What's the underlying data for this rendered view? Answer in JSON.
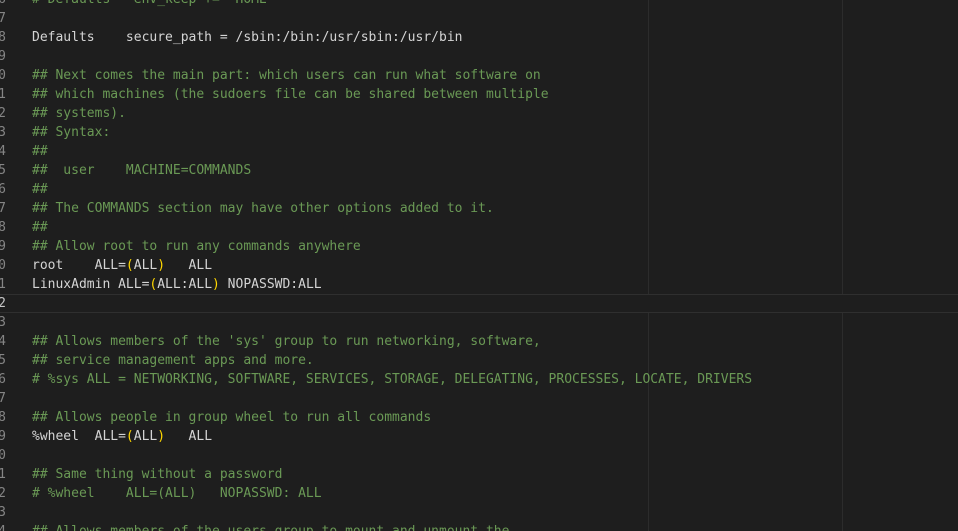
{
  "editor": {
    "colors": {
      "background": "#1e1e1e",
      "comment": "#6a9955",
      "text": "#d4d4d4",
      "bracket": "#ffd700",
      "line_number": "#858585"
    },
    "current_line_index": 16,
    "lines": [
      {
        "num": "6",
        "segments": [
          {
            "t": "comment",
            "v": "# Defaults   env_keep += \"HOME\""
          }
        ]
      },
      {
        "num": "7",
        "segments": []
      },
      {
        "num": "8",
        "segments": [
          {
            "t": "plain",
            "v": "Defaults    secure_path = /sbin:/bin:/usr/sbin:/usr/bin"
          }
        ]
      },
      {
        "num": "9",
        "segments": []
      },
      {
        "num": "0",
        "segments": [
          {
            "t": "comment",
            "v": "## Next comes the main part: which users can run what software on"
          }
        ]
      },
      {
        "num": "1",
        "segments": [
          {
            "t": "comment",
            "v": "## which machines (the sudoers file can be shared between multiple"
          }
        ]
      },
      {
        "num": "2",
        "segments": [
          {
            "t": "comment",
            "v": "## systems)."
          }
        ]
      },
      {
        "num": "3",
        "segments": [
          {
            "t": "comment",
            "v": "## Syntax:"
          }
        ]
      },
      {
        "num": "4",
        "segments": [
          {
            "t": "comment",
            "v": "##"
          }
        ]
      },
      {
        "num": "5",
        "segments": [
          {
            "t": "comment",
            "v": "##  user    MACHINE=COMMANDS"
          }
        ]
      },
      {
        "num": "6",
        "segments": [
          {
            "t": "comment",
            "v": "##"
          }
        ]
      },
      {
        "num": "7",
        "segments": [
          {
            "t": "comment",
            "v": "## The COMMANDS section may have other options added to it."
          }
        ]
      },
      {
        "num": "8",
        "segments": [
          {
            "t": "comment",
            "v": "##"
          }
        ]
      },
      {
        "num": "9",
        "segments": [
          {
            "t": "comment",
            "v": "## Allow root to run any commands anywhere"
          }
        ]
      },
      {
        "num": "0",
        "segments": [
          {
            "t": "plain",
            "v": "root    ALL="
          },
          {
            "t": "paren",
            "v": "("
          },
          {
            "t": "plain",
            "v": "ALL"
          },
          {
            "t": "paren",
            "v": ")"
          },
          {
            "t": "plain",
            "v": "   ALL"
          }
        ]
      },
      {
        "num": "1",
        "segments": [
          {
            "t": "plain",
            "v": "LinuxAdmin ALL="
          },
          {
            "t": "paren",
            "v": "("
          },
          {
            "t": "plain",
            "v": "ALL:ALL"
          },
          {
            "t": "paren",
            "v": ")"
          },
          {
            "t": "plain",
            "v": " NOPASSWD:ALL"
          }
        ]
      },
      {
        "num": "2",
        "segments": []
      },
      {
        "num": "3",
        "segments": []
      },
      {
        "num": "4",
        "segments": [
          {
            "t": "comment",
            "v": "## Allows members of the 'sys' group to run networking, software,"
          }
        ]
      },
      {
        "num": "5",
        "segments": [
          {
            "t": "comment",
            "v": "## service management apps and more."
          }
        ]
      },
      {
        "num": "6",
        "segments": [
          {
            "t": "comment",
            "v": "# %sys ALL = NETWORKING, SOFTWARE, SERVICES, STORAGE, DELEGATING, PROCESSES, LOCATE, DRIVERS"
          }
        ]
      },
      {
        "num": "7",
        "segments": []
      },
      {
        "num": "8",
        "segments": [
          {
            "t": "comment",
            "v": "## Allows people in group wheel to run all commands"
          }
        ]
      },
      {
        "num": "9",
        "segments": [
          {
            "t": "plain",
            "v": "%wheel  ALL="
          },
          {
            "t": "paren",
            "v": "("
          },
          {
            "t": "plain",
            "v": "ALL"
          },
          {
            "t": "paren",
            "v": ")"
          },
          {
            "t": "plain",
            "v": "   ALL"
          }
        ]
      },
      {
        "num": "0",
        "segments": []
      },
      {
        "num": "1",
        "segments": [
          {
            "t": "comment",
            "v": "## Same thing without a password"
          }
        ]
      },
      {
        "num": "2",
        "segments": [
          {
            "t": "comment",
            "v": "# %wheel    ALL=(ALL)   NOPASSWD: ALL"
          }
        ]
      },
      {
        "num": "3",
        "segments": []
      },
      {
        "num": "4",
        "segments": [
          {
            "t": "comment",
            "v": "## Allows members of the users group to mount and unmount the"
          }
        ]
      }
    ]
  }
}
